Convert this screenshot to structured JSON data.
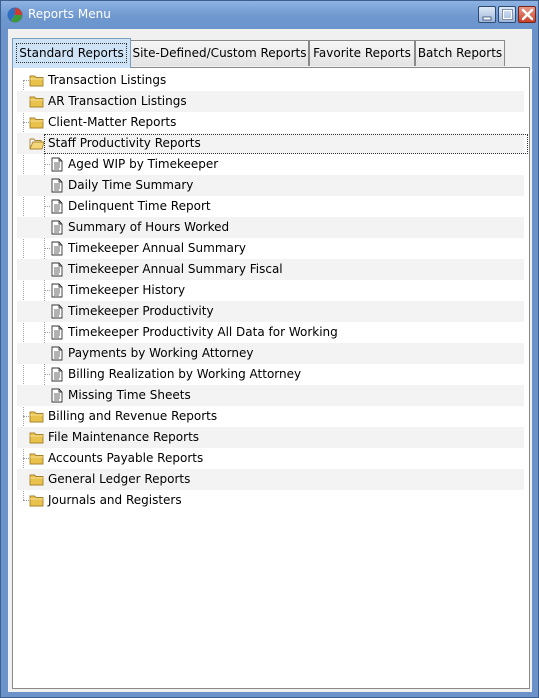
{
  "window": {
    "title": "Reports Menu"
  },
  "tabs": [
    {
      "label": "Standard Reports",
      "active": true
    },
    {
      "label": "Site-Defined/Custom Reports",
      "active": false
    },
    {
      "label": "Favorite Reports",
      "active": false
    },
    {
      "label": "Batch Reports",
      "active": false
    }
  ],
  "tree": {
    "folders_before": [
      {
        "label": "Transaction Listings"
      },
      {
        "label": "AR Transaction Listings"
      },
      {
        "label": "Client-Matter Reports"
      }
    ],
    "open_folder": {
      "label": "Staff Productivity Reports",
      "reports": [
        {
          "label": "Aged WIP by Timekeeper"
        },
        {
          "label": "Daily Time Summary"
        },
        {
          "label": "Delinquent Time Report"
        },
        {
          "label": "Summary of Hours Worked"
        },
        {
          "label": "Timekeeper Annual Summary"
        },
        {
          "label": "Timekeeper Annual Summary Fiscal"
        },
        {
          "label": "Timekeeper History"
        },
        {
          "label": "Timekeeper Productivity"
        },
        {
          "label": "Timekeeper Productivity All Data for Working"
        },
        {
          "label": "Payments by Working Attorney"
        },
        {
          "label": "Billing Realization by Working Attorney"
        },
        {
          "label": "Missing Time Sheets"
        }
      ]
    },
    "folders_after": [
      {
        "label": "Billing and Revenue Reports"
      },
      {
        "label": "File Maintenance Reports"
      },
      {
        "label": "Accounts Payable Reports"
      },
      {
        "label": "General Ledger Reports"
      },
      {
        "label": "Journals and Registers"
      }
    ]
  },
  "icons": {
    "app": "app-icon",
    "folder_closed": "folder-icon",
    "folder_open": "folder-open-icon",
    "report": "document-icon",
    "minimize": "minimize-icon",
    "maximize": "maximize-icon",
    "close": "close-icon"
  },
  "colors": {
    "titlebar": "#6f98cf",
    "active_tab": "#cfe3f7",
    "folder": "#e8c24a",
    "stripe": "#f3f3f3"
  }
}
